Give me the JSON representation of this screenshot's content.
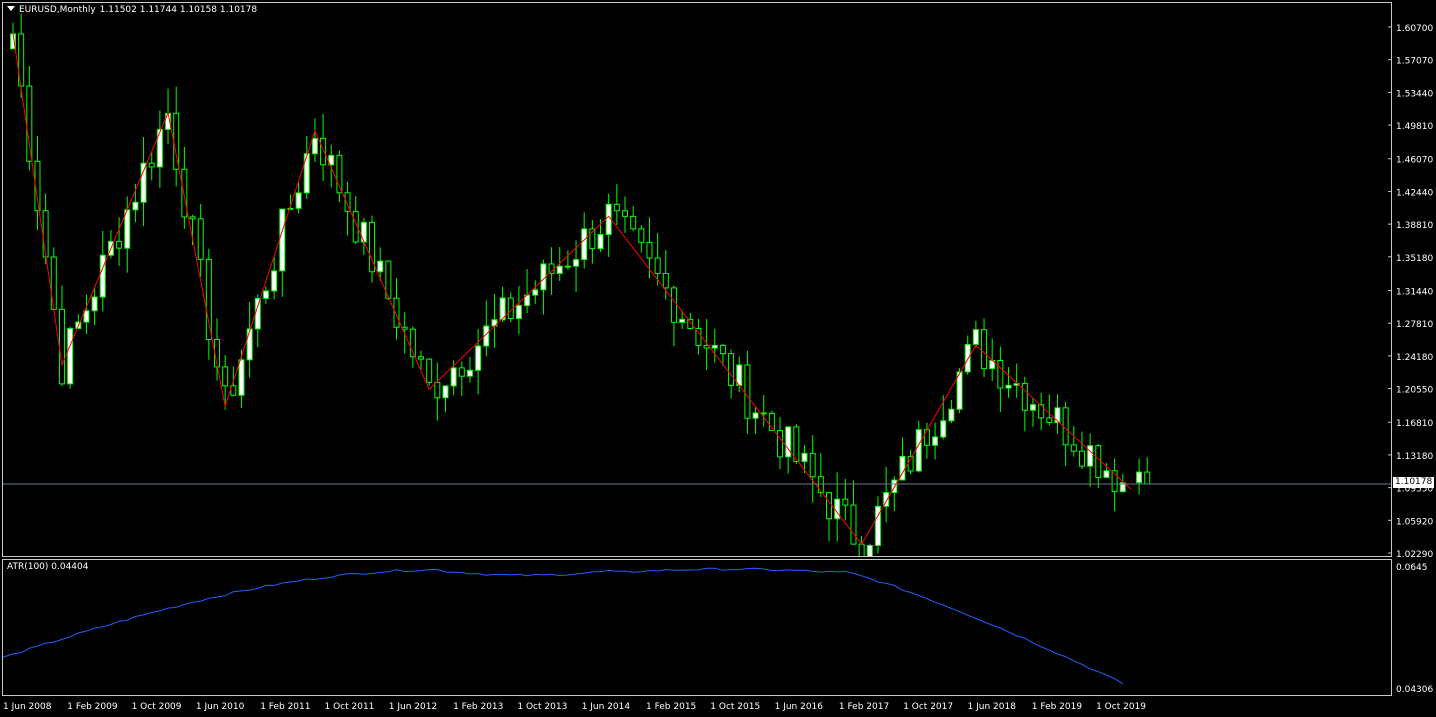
{
  "main": {
    "title_symbol": "EURUSD,Monthly",
    "title_ohlc": "1.11502 1.11744 1.10158 1.10178",
    "price_axis": [
      "1.60700",
      "1.57070",
      "1.53440",
      "1.49810",
      "1.46070",
      "1.42440",
      "1.38810",
      "1.35180",
      "1.31440",
      "1.27810",
      "1.24180",
      "1.20550",
      "1.16810",
      "1.13180",
      "1.09550",
      "1.05920",
      "1.02290"
    ],
    "current_price": "1.10178",
    "colors": {
      "bull": "#ffffff",
      "bear": "#000000",
      "wick": "#00ff00",
      "zigzag": "#ff0000",
      "grid_line": "#6a7a8a",
      "background": "#000000"
    }
  },
  "indicator": {
    "title": "ATR(100) 0.04404",
    "axis_max": "0.0645",
    "axis_min": "0.04306",
    "line_color": "#2060ff"
  },
  "time_axis": [
    "1 Jun 2008",
    "1 Feb 2009",
    "1 Oct 2009",
    "1 Jun 2010",
    "1 Feb 2011",
    "1 Oct 2011",
    "1 Jun 2012",
    "1 Feb 2013",
    "1 Oct 2013",
    "1 Jun 2014",
    "1 Feb 2015",
    "1 Oct 2015",
    "1 Jun 2016",
    "1 Feb 2017",
    "1 Oct 2017",
    "1 Jun 2018",
    "1 Feb 2019",
    "1 Oct 2019"
  ],
  "chart_data": {
    "type": "candlestick",
    "zigzag": [
      {
        "x": "2008-04",
        "y": 1.602
      },
      {
        "x": "2008-10",
        "y": 1.234
      },
      {
        "x": "2009-11",
        "y": 1.514
      },
      {
        "x": "2010-06",
        "y": 1.188
      },
      {
        "x": "2011-05",
        "y": 1.494
      },
      {
        "x": "2012-07",
        "y": 1.207
      },
      {
        "x": "2014-05",
        "y": 1.399
      },
      {
        "x": "2016-12",
        "y": 1.035
      },
      {
        "x": "2018-02",
        "y": 1.256
      },
      {
        "x": "2019-09",
        "y": 1.096
      }
    ],
    "atr_range": [
      0.04306,
      0.0645
    ]
  }
}
